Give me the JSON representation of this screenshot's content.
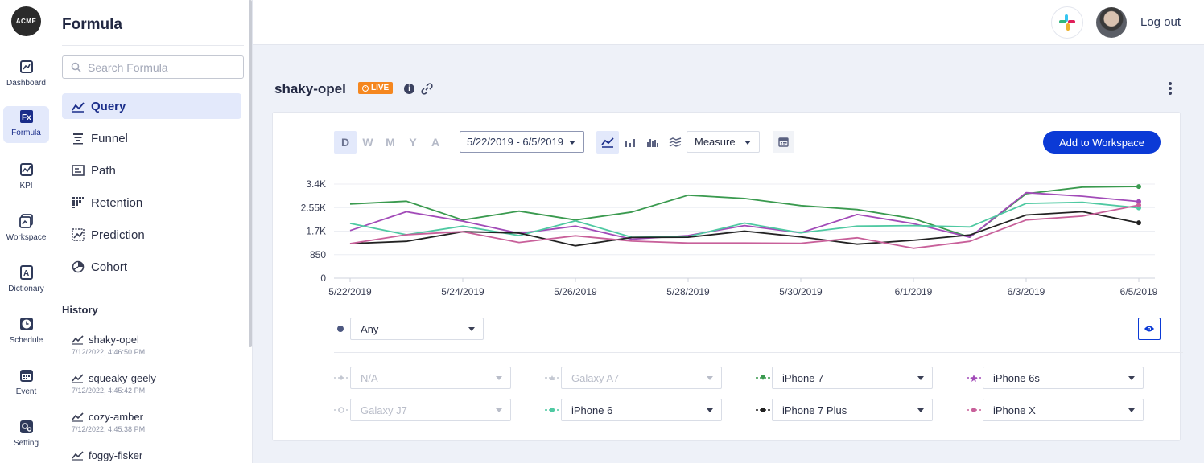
{
  "rail": {
    "logo": "ACME",
    "items": [
      {
        "label": "Dashboard",
        "icon": "dashboard-icon"
      },
      {
        "label": "Formula",
        "icon": "formula-icon",
        "active": true
      },
      {
        "label": "KPI",
        "icon": "kpi-icon"
      },
      {
        "label": "Workspace",
        "icon": "workspace-icon"
      },
      {
        "label": "Dictionary",
        "icon": "dictionary-icon"
      },
      {
        "label": "Schedule",
        "icon": "clock-icon"
      },
      {
        "label": "Event",
        "icon": "calendar-icon"
      },
      {
        "label": "Setting",
        "icon": "gear-icon"
      }
    ]
  },
  "panel": {
    "title": "Formula",
    "search_placeholder": "Search Formula",
    "menu": [
      {
        "label": "Query",
        "active": true
      },
      {
        "label": "Funnel"
      },
      {
        "label": "Path"
      },
      {
        "label": "Retention"
      },
      {
        "label": "Prediction"
      },
      {
        "label": "Cohort"
      }
    ],
    "history_title": "History",
    "history": [
      {
        "name": "shaky-opel",
        "time": "7/12/2022, 4:46:50 PM"
      },
      {
        "name": "squeaky-geely",
        "time": "7/12/2022, 4:45:42 PM"
      },
      {
        "name": "cozy-amber",
        "time": "7/12/2022, 4:45:38 PM"
      },
      {
        "name": "foggy-fisker",
        "time": ""
      }
    ]
  },
  "topbar": {
    "logout": "Log out"
  },
  "query": {
    "name": "shaky-opel",
    "live_label": "LIVE",
    "granularity": [
      "D",
      "W",
      "M",
      "Y",
      "A"
    ],
    "date_range": "5/22/2019 - 6/5/2019",
    "measure": "Measure",
    "add_button": "Add to Workspace",
    "filter_value": "Any"
  },
  "colors": {
    "accent": "#0b3ad6",
    "live": "#f5871f",
    "iphone7": "#3a9a4f",
    "iphone6s": "#a24bb8",
    "iphone6": "#4fc9a2",
    "iphone7plus": "#222222",
    "iphonex": "#c8609a"
  },
  "legend": [
    {
      "label": "N/A",
      "active": false,
      "color": "#c4c8d2",
      "marker": "diamond"
    },
    {
      "label": "Galaxy A7",
      "active": false,
      "color": "#c4c8d2",
      "marker": "triangle"
    },
    {
      "label": "iPhone 7",
      "active": true,
      "color": "#3a9a4f",
      "marker": "triangle-down"
    },
    {
      "label": "iPhone 6s",
      "active": true,
      "color": "#a24bb8",
      "marker": "star"
    },
    {
      "label": "Galaxy J7",
      "active": false,
      "color": "#c4c8d2",
      "marker": "circle-open"
    },
    {
      "label": "iPhone 6",
      "active": true,
      "color": "#4fc9a2",
      "marker": "circle"
    },
    {
      "label": "iPhone 7 Plus",
      "active": true,
      "color": "#222222",
      "marker": "circle"
    },
    {
      "label": "iPhone X",
      "active": true,
      "color": "#c8609a",
      "marker": "circle"
    }
  ],
  "chart_data": {
    "type": "line",
    "x": [
      "5/22/2019",
      "5/23/2019",
      "5/24/2019",
      "5/25/2019",
      "5/26/2019",
      "5/27/2019",
      "5/28/2019",
      "5/29/2019",
      "5/30/2019",
      "5/31/2019",
      "6/1/2019",
      "6/2/2019",
      "6/3/2019",
      "6/4/2019",
      "6/5/2019"
    ],
    "x_tick_labels": [
      "5/22/2019",
      "5/24/2019",
      "5/26/2019",
      "5/28/2019",
      "5/30/2019",
      "6/1/2019",
      "6/3/2019",
      "6/5/2019"
    ],
    "y_tick_labels": [
      "0",
      "850",
      "1.7K",
      "2.55K",
      "3.4K"
    ],
    "ylim": [
      0,
      3400
    ],
    "grid": true,
    "series": [
      {
        "name": "iPhone 7",
        "color": "#3a9a4f",
        "values": [
          2680,
          2780,
          2100,
          2420,
          2100,
          2390,
          3000,
          2880,
          2620,
          2480,
          2150,
          1480,
          3050,
          3290,
          3310
        ]
      },
      {
        "name": "iPhone 6s",
        "color": "#a24bb8",
        "values": [
          1720,
          2400,
          2060,
          1620,
          1880,
          1410,
          1540,
          1900,
          1640,
          2300,
          1970,
          1480,
          3090,
          2960,
          2770
        ]
      },
      {
        "name": "iPhone 6",
        "color": "#4fc9a2",
        "values": [
          1980,
          1570,
          1880,
          1540,
          2070,
          1480,
          1500,
          1990,
          1640,
          1880,
          1900,
          1850,
          2700,
          2740,
          2540
        ]
      },
      {
        "name": "iPhone 7 Plus",
        "color": "#222222",
        "values": [
          1250,
          1330,
          1680,
          1630,
          1170,
          1470,
          1480,
          1700,
          1490,
          1230,
          1370,
          1560,
          2280,
          2400,
          2000
        ]
      },
      {
        "name": "iPhone X",
        "color": "#c8609a",
        "values": [
          1250,
          1570,
          1680,
          1290,
          1530,
          1340,
          1270,
          1270,
          1260,
          1460,
          1080,
          1330,
          2100,
          2240,
          2640
        ]
      }
    ]
  }
}
